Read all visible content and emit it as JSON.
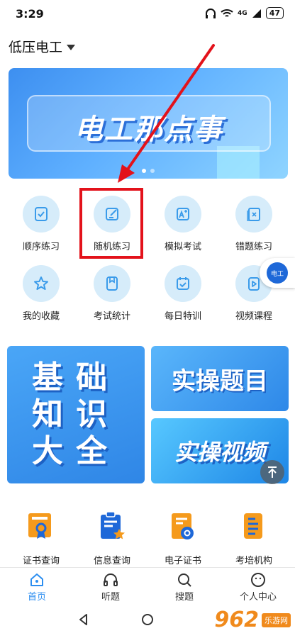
{
  "status_bar": {
    "time": "3:29",
    "battery": "47",
    "network": "4G"
  },
  "header": {
    "title": "低压电工"
  },
  "banner": {
    "text": "电工那点事"
  },
  "practice_grid": [
    {
      "label": "顺序练习",
      "icon": "ordered-list-icon"
    },
    {
      "label": "随机练习",
      "icon": "edit-note-icon"
    },
    {
      "label": "模拟考试",
      "icon": "a-plus-icon"
    },
    {
      "label": "错题练习",
      "icon": "wrong-book-icon"
    },
    {
      "label": "我的收藏",
      "icon": "star-icon"
    },
    {
      "label": "考试统计",
      "icon": "bookmark-icon"
    },
    {
      "label": "每日特训",
      "icon": "calendar-check-icon"
    },
    {
      "label": "视频课程",
      "icon": "video-icon"
    }
  ],
  "float_badge": {
    "text": "电工"
  },
  "cards": {
    "basic_knowledge": "基础知识大全",
    "practice_questions": "实操题目",
    "practice_video": "实操视频"
  },
  "tools": [
    {
      "label": "证书查询",
      "icon": "certificate-icon"
    },
    {
      "label": "信息查询",
      "icon": "clipboard-star-icon"
    },
    {
      "label": "电子证书",
      "icon": "e-certificate-icon"
    },
    {
      "label": "考培机构",
      "icon": "institution-icon"
    }
  ],
  "tabbar": [
    {
      "label": "首页",
      "icon": "home-icon",
      "active": true
    },
    {
      "label": "听题",
      "icon": "headphones-icon",
      "active": false
    },
    {
      "label": "搜题",
      "icon": "search-icon",
      "active": false
    },
    {
      "label": "个人中心",
      "icon": "profile-icon",
      "active": false
    }
  ],
  "watermark": {
    "logo": "962",
    "text": "乐游网"
  },
  "colors": {
    "accent": "#2c8ef0",
    "icon_bg": "#d6ecfa",
    "highlight": "#e3121b",
    "tool_orange": "#f59a1c",
    "tool_blue": "#1e68d8"
  }
}
